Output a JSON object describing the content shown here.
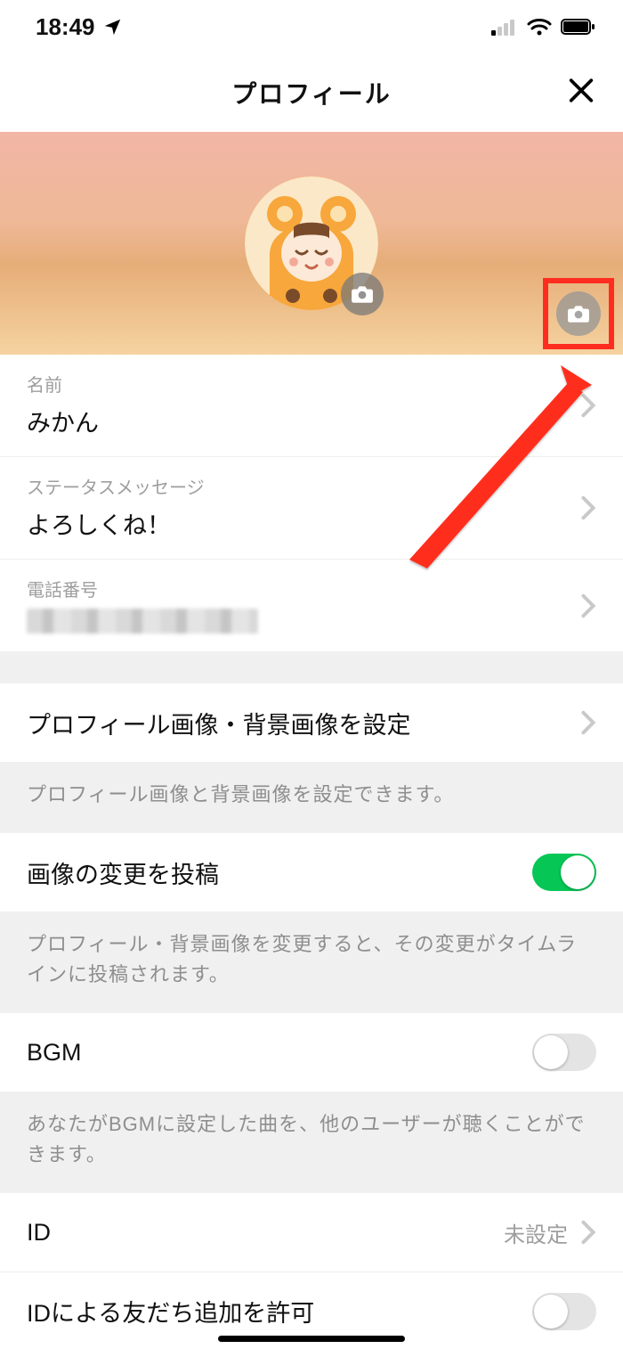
{
  "status": {
    "time": "18:49"
  },
  "nav": {
    "title": "プロフィール"
  },
  "profile": {
    "name_label": "名前",
    "name_value": "みかん",
    "status_label": "ステータスメッセージ",
    "status_value": "よろしくね！",
    "phone_label": "電話番号"
  },
  "settings": {
    "images_row": "プロフィール画像・背景画像を設定",
    "images_help": "プロフィール画像と背景画像を設定できます。",
    "post_row": "画像の変更を投稿",
    "post_help": "プロフィール・背景画像を変更すると、その変更がタイムラインに投稿されます。",
    "bgm_row": "BGM",
    "bgm_help": "あなたがBGMに設定した曲を、他のユーザーが聴くことができます。",
    "id_row": "ID",
    "id_value": "未設定",
    "id_add_row": "IDによる友だち追加を許可"
  }
}
